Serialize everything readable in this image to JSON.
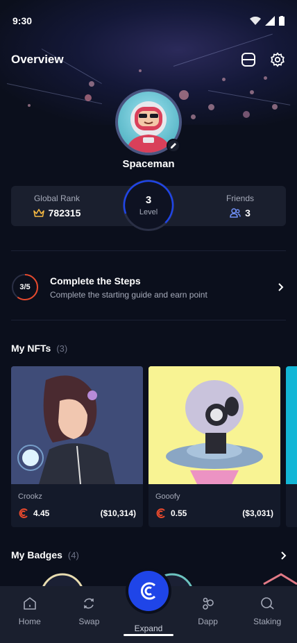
{
  "status_bar": {
    "time": "9:30"
  },
  "header": {
    "title": "Overview"
  },
  "profile": {
    "username": "Spaceman"
  },
  "stats": {
    "global_rank_label": "Global Rank",
    "global_rank_value": "782315",
    "level_value": "3",
    "level_label": "Level",
    "friends_label": "Friends",
    "friends_value": "3"
  },
  "steps": {
    "progress": "3/5",
    "progress_fraction": 0.6,
    "title": "Complete the Steps",
    "subtitle": "Complete the starting guide and earn point"
  },
  "nfts": {
    "title": "My NFTs",
    "count": "(3)",
    "items": [
      {
        "name": "Crookz",
        "amount": "4.45",
        "usd": "($10,314)"
      },
      {
        "name": "Gooofy",
        "amount": "0.55",
        "usd": "($3,031)"
      }
    ]
  },
  "badges": {
    "title": "My Badges",
    "count": "(4)"
  },
  "tabbar": {
    "items": [
      {
        "label": "Home",
        "icon": "home-icon"
      },
      {
        "label": "Swap",
        "icon": "swap-icon"
      },
      {
        "label": "Expand",
        "icon": "expand-logo-icon"
      },
      {
        "label": "Dapp",
        "icon": "dapp-icon"
      },
      {
        "label": "Staking",
        "icon": "staking-icon"
      }
    ]
  },
  "colors": {
    "background": "#0b0f1c",
    "card": "#1a1f2e",
    "accent_blue": "#1f45e8",
    "accent_red": "#e8492c",
    "rank_gold": "#f5b942"
  }
}
